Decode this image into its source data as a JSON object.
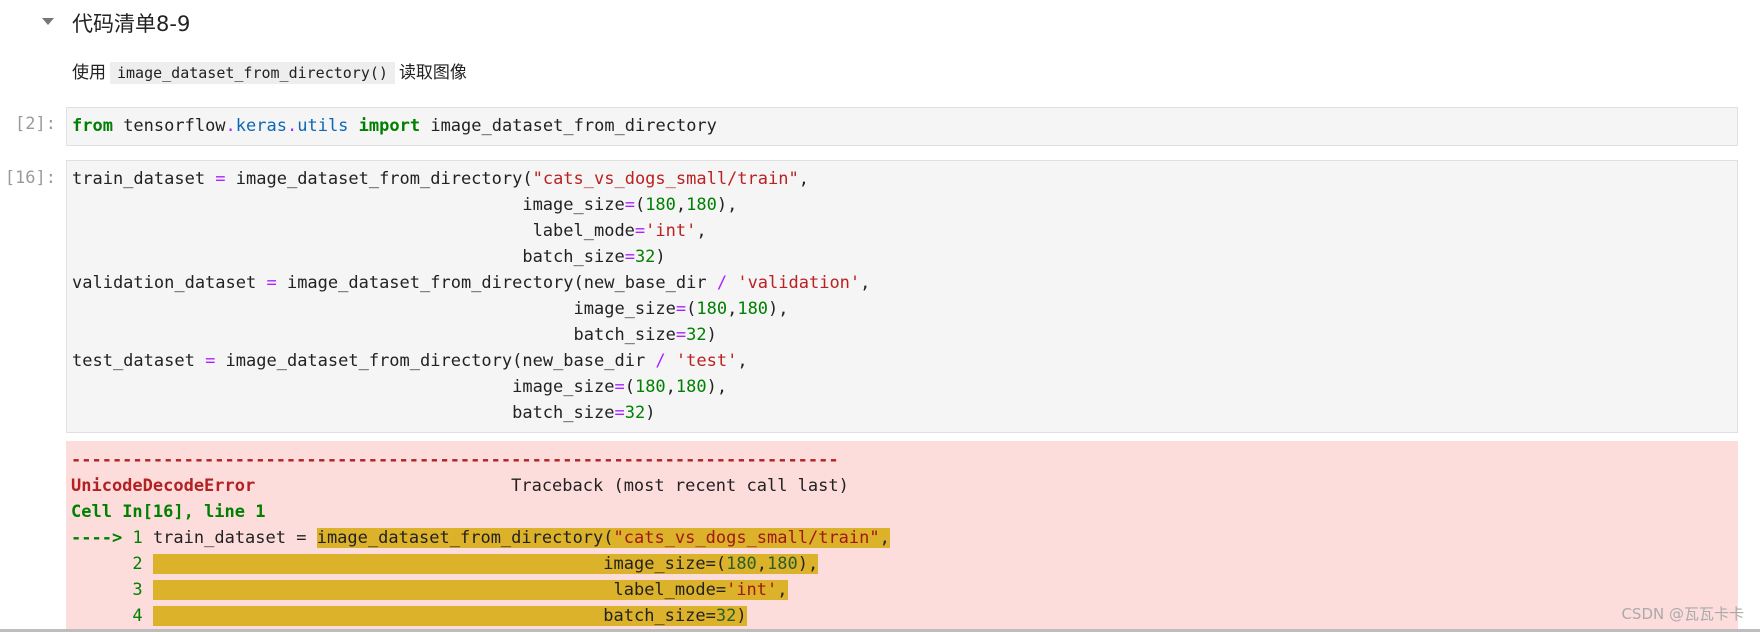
{
  "section": {
    "heading": "代码清单8-9",
    "desc_before": "使用",
    "desc_code": "image_dataset_from_directory()",
    "desc_after": "读取图像"
  },
  "cells": [
    {
      "prompt": "[2]:",
      "code": "from tensorflow.keras.utils import image_dataset_from_directory"
    },
    {
      "prompt": "[16]:",
      "code": "train_dataset = image_dataset_from_directory(\"cats_vs_dogs_small/train\",\n                                            image_size=(180,180),\n                                             label_mode='int',\n                                            batch_size=32)\nvalidation_dataset = image_dataset_from_directory(new_base_dir / 'validation',\n                                                 image_size=(180,180),\n                                                 batch_size=32)\ntest_dataset = image_dataset_from_directory(new_base_dir / 'test',\n                                           image_size=(180,180),\n                                           batch_size=32)"
    }
  ],
  "error_output": {
    "separator": "---------------------------------------------------------------------------",
    "error_type": "UnicodeDecodeError",
    "traceback_label": "Traceback (most recent call last)",
    "cell_ref_prefix": "Cell ",
    "cell_ref": "In[16], line 1",
    "arrow": "---->",
    "lines": [
      {
        "no": "1",
        "pre": "train_dataset = ",
        "code": "image_dataset_from_directory(\"cats_vs_dogs_small/train\","
      },
      {
        "no": "2",
        "code": "                                            image_size=(180,180),"
      },
      {
        "no": "3",
        "code": "                                             label_mode='int',"
      },
      {
        "no": "4",
        "code": "                                            batch_size=32)"
      }
    ]
  },
  "watermark": "CSDN @瓦瓦卡卡"
}
